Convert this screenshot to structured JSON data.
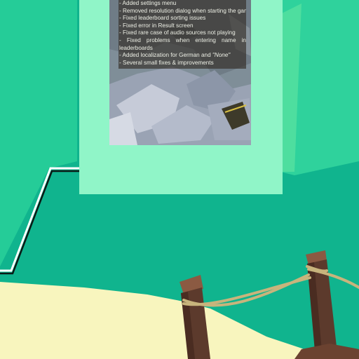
{
  "changelog": {
    "lines": [
      "- Added settings menu",
      "- Removed resolution dialog when starting the game",
      "- Fixed leaderboard sorting issues",
      "- Fixed error in Result screen",
      "- Fixed rare case of audio sources not playing",
      "- Fixed problems when entering name in leaderboards",
      "- Added localization for German and",
      "- Several small fixes & improvements"
    ],
    "localization_language_2": "\"None\""
  },
  "colors": {
    "sea": "#10b48e",
    "panel": "#90f5c8",
    "sand": "#f8f5be",
    "post": "#5c3a2c",
    "rope": "#c8b47c"
  }
}
